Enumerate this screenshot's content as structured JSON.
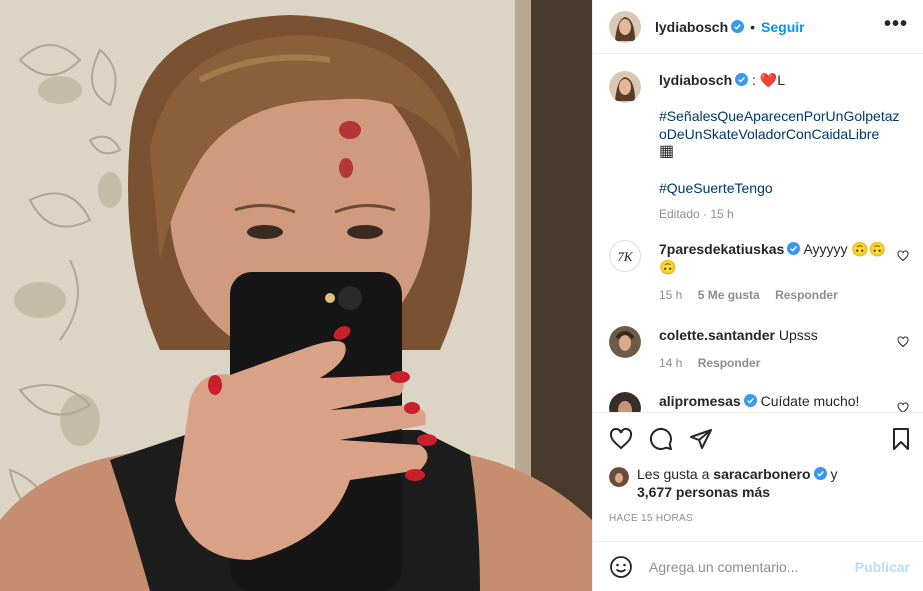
{
  "post": {
    "username": "lydiabosch",
    "follow_label": "Seguir",
    "separator": "•",
    "more_label": "•••"
  },
  "caption": {
    "username": "lydiabosch",
    "text_prefix": " : ",
    "heart": "❤️",
    "text_suffix": "L",
    "hashtag1": "#SeñalesQueAparecenPorUnGolpetazoDeUnSkateVoladorConCaidaLibre",
    "emoji_line": "▦",
    "hashtag2": "#QueSuerteTengo",
    "edited": "Editado",
    "edited_time": "15 h"
  },
  "comments": [
    {
      "username": "7paresdekatiuskas",
      "text": "Ayyyyy 🙃🙃🙃",
      "time": "15 h",
      "likes": "5 Me gusta",
      "reply": "Responder"
    },
    {
      "username": "colette.santander",
      "text": "Upsss",
      "time": "14 h",
      "reply": "Responder"
    },
    {
      "username": "alipromesas",
      "text": "Cuídate mucho!"
    }
  ],
  "likes": {
    "prefix": "Les gusta a ",
    "user": "saracarbonero",
    "suffix": " y",
    "count": "3,677 personas más"
  },
  "timestamp": "HACE 15 HORAS",
  "add_comment": {
    "placeholder": "Agrega un comentario...",
    "publish_label": "Publicar"
  },
  "colors": {
    "accent": "#0095f6",
    "publish_disabled": "#b2dffc",
    "hashtag": "#00376b",
    "muted": "#8e8e8e",
    "verified": "#3897f0"
  },
  "icons": [
    "verified-icon",
    "more-icon",
    "heart-icon",
    "comment-icon",
    "share-icon",
    "bookmark-icon",
    "emoji-icon"
  ]
}
